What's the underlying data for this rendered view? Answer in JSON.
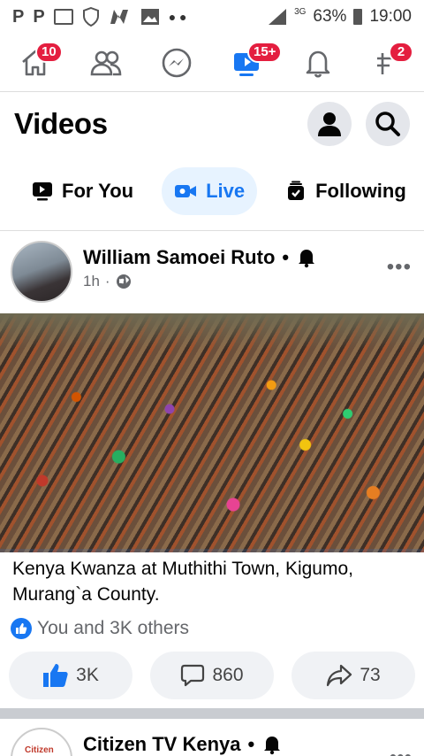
{
  "status_bar": {
    "left_icons": [
      "P",
      "P"
    ],
    "network": "3G",
    "battery": "63%",
    "time": "19:00"
  },
  "nav": {
    "home_badge": "10",
    "watch_badge": "15+",
    "menu_badge": "2"
  },
  "header": {
    "title": "Videos"
  },
  "tabs": [
    {
      "label": "For You"
    },
    {
      "label": "Live"
    },
    {
      "label": "Following"
    }
  ],
  "post": {
    "author": "William Samoei Ruto",
    "dot": "•",
    "time": "1h",
    "sep": "·",
    "caption": "Kenya Kwanza at Muthithi Town, Kigumo, Murang`a County.",
    "reactions": "You and 3K others",
    "likes": "3K",
    "comments": "860",
    "shares": "73",
    "more": "•••"
  },
  "post2": {
    "author": "Citizen TV Kenya",
    "dot": "•",
    "avatar_text": "Citizen",
    "more": "•••"
  },
  "colors": {
    "brand": "#1877f2",
    "badge": "#e41e3f"
  }
}
